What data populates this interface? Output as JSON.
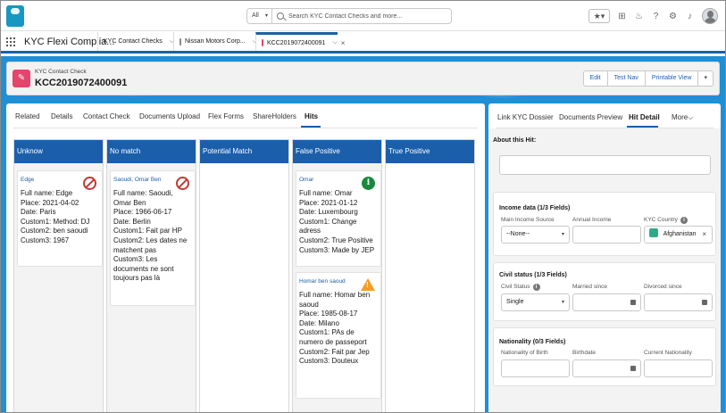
{
  "topbar": {
    "search_scope": "All",
    "search_placeholder": "Search KYC Contact Checks and more..."
  },
  "nav": {
    "app_name": "KYC Flexi Complia...",
    "tabs": [
      {
        "label": "KYC Contact Checks"
      },
      {
        "label": "Nissan Motors Corp..."
      },
      {
        "label": "KCC2019072400091"
      }
    ]
  },
  "record": {
    "type_label": "KYC Contact Check",
    "title": "KCC2019072400091",
    "actions": [
      "Edit",
      "Test Nav",
      "Printable View"
    ]
  },
  "left_tabs": [
    "Related",
    "Details",
    "Contact Check",
    "Documents Upload",
    "Flex Forms",
    "ShareHolders",
    "Hits"
  ],
  "columns": [
    {
      "header": "Unknow",
      "cards": [
        {
          "name": "Edge",
          "badge": "no",
          "lines": [
            "Full name: Edge",
            "Place: 2021-04-02",
            "Date: Paris",
            "Custom1: Method: DJ",
            "Custom2: ben saoudi",
            "Custom3: 1967"
          ]
        }
      ]
    },
    {
      "header": "No match",
      "cards": [
        {
          "name": "Saoudi, Omar Ben",
          "badge": "no",
          "lines": [
            "Full name: Saoudi, Omar Ben",
            "Place: 1966-06-17",
            "Date: Berlin",
            "Custom1: Fait par HP",
            "Custom2: Les dates ne matchent pas",
            "Custom3: Les documents ne sont toujours pas là"
          ]
        }
      ]
    },
    {
      "header": "Potential Match",
      "cards": []
    },
    {
      "header": "False Positive",
      "cards": [
        {
          "name": "Omar",
          "badge": "info",
          "lines": [
            "Full name: Omar",
            "Place: 2021-01-12",
            "Date: Luxembourg",
            "Custom1: Change adress",
            "Custom2: True Positive",
            "Custom3: Made by JEP"
          ]
        },
        {
          "name": "Homar ben saoud",
          "badge": "warn",
          "lines": [
            "Full name: Homar ben saoud",
            "Place: 1985-08-17",
            "Date: Milano",
            "Custom1: PAs de numero de passeport",
            "Custom2: Fait par Jep",
            "Custom3: Douteux"
          ]
        }
      ]
    },
    {
      "header": "True Positive",
      "cards": []
    }
  ],
  "right_tabs": [
    "Link KYC Dossier",
    "Documents Preview",
    "Hit Detail",
    "More"
  ],
  "hit_detail": {
    "about_label": "About this Hit:",
    "income": {
      "title": "Income data (1/3 Fields)",
      "main_source_label": "Main Income Source",
      "main_source_value": "--None--",
      "annual_income_label": "Annual Income",
      "kyc_country_label": "KYC Country",
      "kyc_country_value": "Afghanistan"
    },
    "civil": {
      "title": "Civil status (1/3 Fields)",
      "civil_status_label": "Civil Status",
      "civil_status_value": "Single",
      "married_since_label": "Married since",
      "divorced_since_label": "Divorced since"
    },
    "nationality": {
      "title": "Nationality (0/3 Fields)",
      "birth_label": "Nationality of Birth",
      "birthdate_label": "Birthdate",
      "current_label": "Current Nationality"
    }
  }
}
